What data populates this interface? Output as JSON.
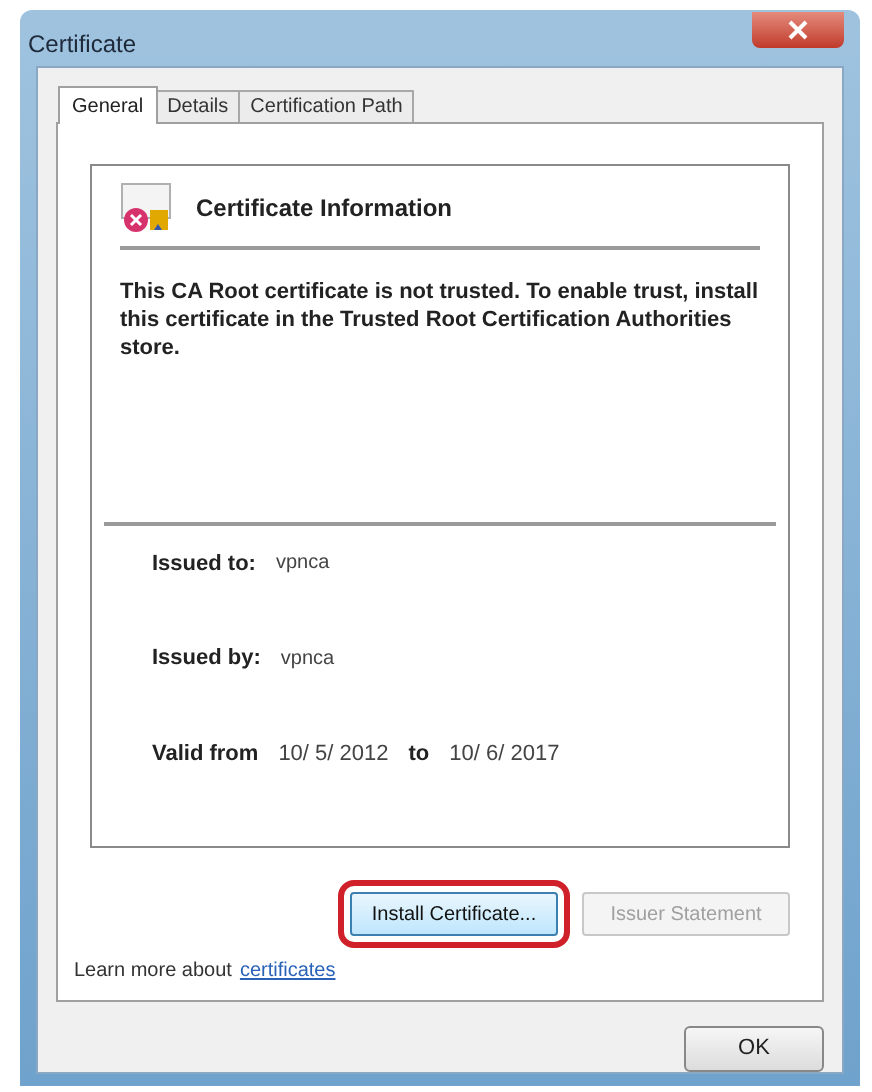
{
  "window": {
    "title": "Certificate"
  },
  "tabs": [
    {
      "label": "General",
      "selected": true
    },
    {
      "label": "Details",
      "selected": false
    },
    {
      "label": "Certification Path",
      "selected": false
    }
  ],
  "info": {
    "heading": "Certificate Information",
    "message": "This CA Root certificate is not trusted. To enable trust, install this certificate in the Trusted Root Certification Authorities store."
  },
  "fields": [
    {
      "label": "Issued to:",
      "value": "vpnca"
    },
    {
      "label": "Issued by:",
      "value": "vpnca"
    }
  ],
  "validity": {
    "label": "Valid from",
    "from": "10/ 5/ 2012",
    "to_label": "to",
    "to": "10/ 6/ 2017"
  },
  "buttons": [
    {
      "label": "Install Certificate...",
      "disabled": false,
      "highlighted": true
    },
    {
      "label": "Issuer Statement",
      "disabled": true,
      "highlighted": false
    }
  ],
  "learn_more": {
    "text": "Learn more about",
    "link": "certificates"
  },
  "ok_button": {
    "label": "OK"
  }
}
